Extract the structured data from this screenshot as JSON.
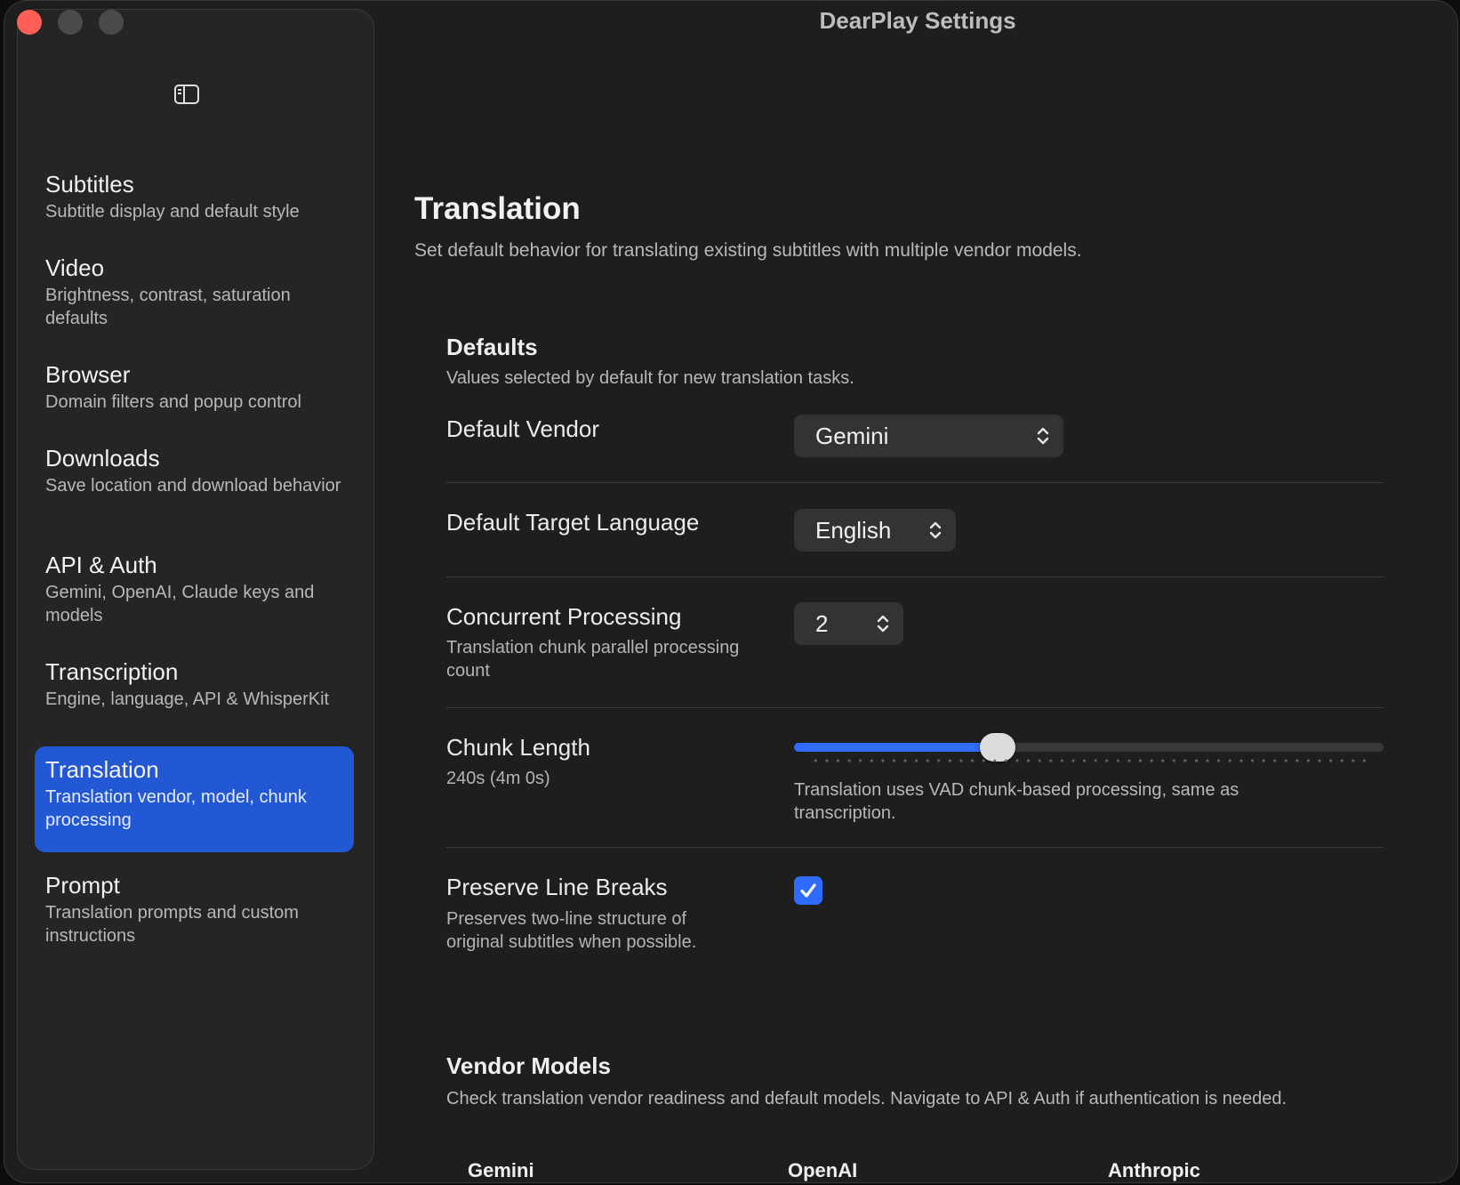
{
  "window": {
    "title": "DearPlay Settings"
  },
  "sidebar": {
    "items": [
      {
        "title": "Subtitles",
        "subtitle": "Subtitle display and default style"
      },
      {
        "title": "Video",
        "subtitle": "Brightness, contrast, saturation defaults"
      },
      {
        "title": "Browser",
        "subtitle": "Domain filters and popup control"
      },
      {
        "title": "Downloads",
        "subtitle": "Save location and download behavior"
      },
      {
        "title": "API & Auth",
        "subtitle": "Gemini, OpenAI, Claude keys and models"
      },
      {
        "title": "Transcription",
        "subtitle": "Engine, language, API & WhisperKit"
      },
      {
        "title": "Translation",
        "subtitle": "Translation vendor, model, chunk processing"
      },
      {
        "title": "Prompt",
        "subtitle": "Translation prompts and custom instructions"
      }
    ],
    "selected": "Translation"
  },
  "page": {
    "title": "Translation",
    "subtitle": "Set default behavior for translating existing subtitles with multiple vendor models."
  },
  "defaults": {
    "title": "Defaults",
    "subtitle": "Values selected by default for new translation tasks.",
    "vendor": {
      "label": "Default Vendor",
      "value": "Gemini"
    },
    "target_language": {
      "label": "Default Target Language",
      "value": "English"
    },
    "concurrent": {
      "label": "Concurrent Processing",
      "description": "Translation chunk parallel processing count",
      "value": "2"
    },
    "chunk_length": {
      "label": "Chunk Length",
      "value_text": "240s (4m 0s)",
      "slider_fraction": 0.345,
      "note": "Translation uses VAD chunk-based processing, same as transcription."
    },
    "preserve_line_breaks": {
      "label": "Preserve Line Breaks",
      "description": "Preserves two-line structure of original subtitles when possible.",
      "checked": true
    }
  },
  "vendor_models": {
    "title": "Vendor Models",
    "subtitle": "Check translation vendor readiness and default models. Navigate to API & Auth if authentication is needed.",
    "columns": [
      "Gemini",
      "OpenAI",
      "Anthropic"
    ]
  },
  "colors": {
    "accent": "#2f6bff",
    "selection": "#2358d4",
    "close": "#ff5f57"
  },
  "icons": {
    "sidebar_toggle": "sidebar-icon",
    "stepper": "chevron-up-down-icon",
    "check": "checkmark-icon"
  }
}
